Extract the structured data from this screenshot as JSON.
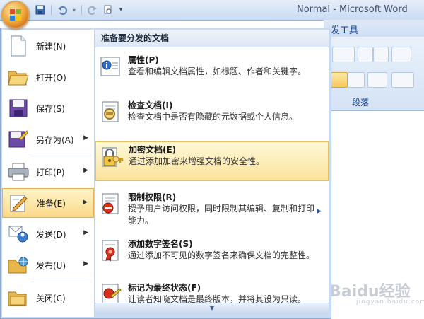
{
  "window": {
    "title": "Normal - Microsoft Word"
  },
  "ribbon": {
    "tab_partial": "发工具",
    "group_label": "段落"
  },
  "menu": {
    "left_items": [
      {
        "label": "新建(N)",
        "icon": "new-document-icon",
        "submenu": false
      },
      {
        "label": "打开(O)",
        "icon": "open-folder-icon",
        "submenu": false
      },
      {
        "label": "保存(S)",
        "icon": "save-floppy-icon",
        "submenu": false
      },
      {
        "label": "另存为(A)",
        "icon": "save-as-icon",
        "submenu": true
      },
      {
        "label": "打印(P)",
        "icon": "printer-icon",
        "submenu": true
      },
      {
        "label": "准备(E)",
        "icon": "prepare-pencil-icon",
        "submenu": true,
        "selected": true
      },
      {
        "label": "发送(D)",
        "icon": "send-icon",
        "submenu": true
      },
      {
        "label": "发布(U)",
        "icon": "publish-icon",
        "submenu": true
      },
      {
        "label": "关闭(C)",
        "icon": "close-folder-icon",
        "submenu": false
      }
    ],
    "panel_title": "准备要分发的文档",
    "right_items": [
      {
        "title": "属性(P)",
        "desc": "查看和编辑文档属性，如标题、作者和关键字。",
        "icon": "properties-icon"
      },
      {
        "title": "检查文档(I)",
        "desc": "检查文档中是否有隐藏的元数据或个人信息。",
        "icon": "inspect-document-icon"
      },
      {
        "title": "加密文档(E)",
        "desc": "通过添加加密来增强文档的安全性。",
        "icon": "encrypt-lock-icon",
        "selected": true
      },
      {
        "title": "限制权限(R)",
        "desc": "授予用户访问权限，同时限制其编辑、复制和打印能力。",
        "icon": "restrict-permission-icon",
        "submenu": true
      },
      {
        "title": "添加数字签名(S)",
        "desc": "通过添加不可见的数字签名来确保文档的完整性。",
        "icon": "digital-signature-icon"
      },
      {
        "title": "标记为最终状态(F)",
        "desc": "让读者知晓文档是最终版本，并将其设为只读。",
        "icon": "mark-final-icon"
      }
    ]
  },
  "watermark": {
    "text": "Baidu经验",
    "sub": "jingyan.baidu.com"
  },
  "colors": {
    "accent": "#f8c95b",
    "menu_frame": "#c9d9ef",
    "title_text": "#3d4f71"
  }
}
